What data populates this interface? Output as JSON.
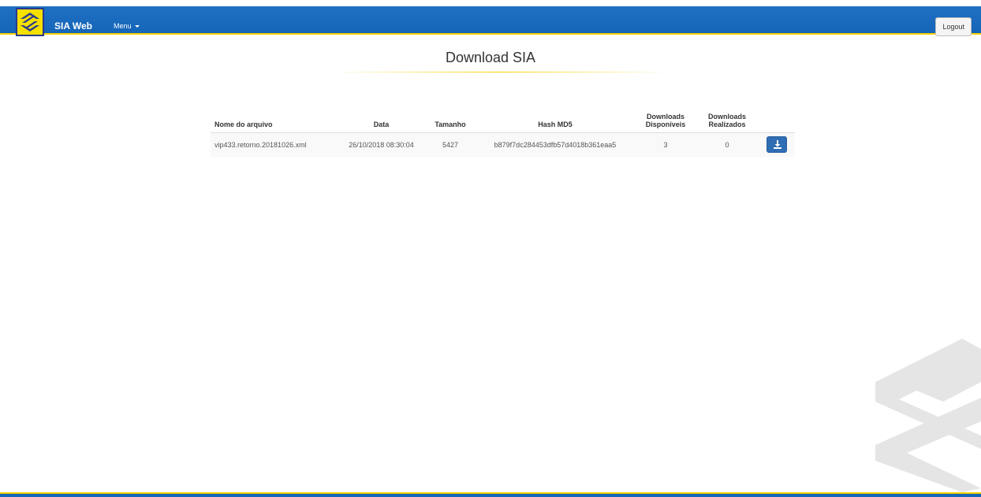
{
  "navbar": {
    "brand": "SIA Web",
    "menu_label": "Menu",
    "logout_label": "Logout",
    "bg_color": "#1565b8",
    "accent_color": "#f5d100"
  },
  "page": {
    "title": "Download SIA"
  },
  "table": {
    "columns": {
      "nome": "Nome do arquivo",
      "data": "Data",
      "tamanho": "Tamanho",
      "hash": "Hash MD5",
      "disp_1": "Downloads",
      "disp_2": "Disponíveis",
      "real_1": "Downloads",
      "real_2": "Realizados"
    },
    "rows": [
      {
        "nome": "vip433.retorno.20181026.xml",
        "data": "26/10/2018 08:30:04",
        "tamanho": "5427",
        "hash": "b879f7dc284453dfb57d4018b361eaa5",
        "disponiveis": "3",
        "realizados": "0",
        "action_icon": "download-icon"
      }
    ]
  }
}
